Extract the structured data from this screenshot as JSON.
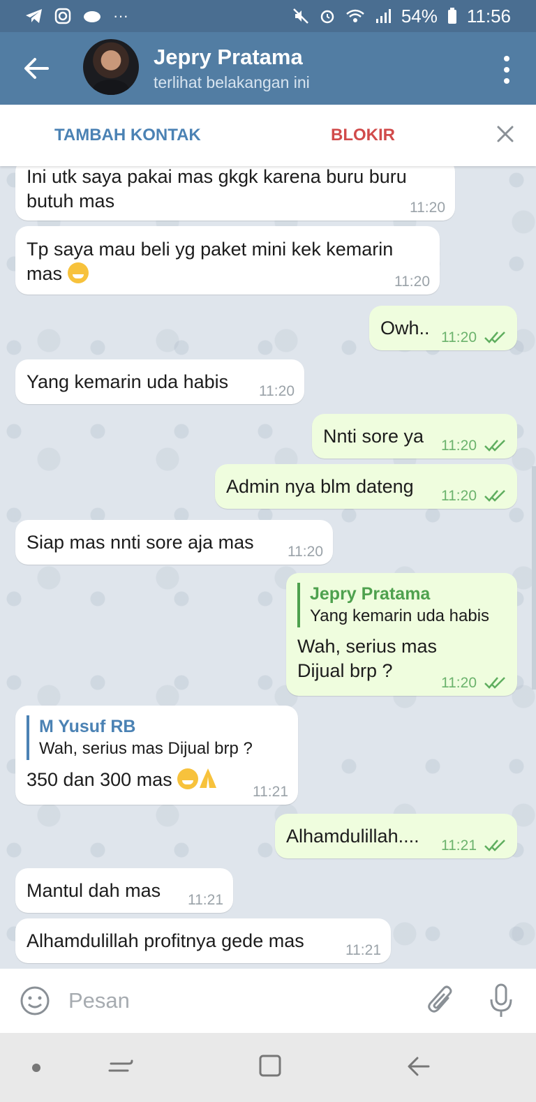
{
  "status_bar": {
    "battery": "54%",
    "time": "11:56"
  },
  "header": {
    "name": "Jepry Pratama",
    "status": "terlihat belakangan ini"
  },
  "action_bar": {
    "add_contact": "TAMBAH KONTAK",
    "block": "BLOKIR"
  },
  "messages": [
    {
      "dir": "in",
      "lines": [
        "Ini utk saya pakai mas gkgk karena buru buru",
        "butuh mas"
      ],
      "time": "11:20"
    },
    {
      "dir": "in",
      "lines": [
        "Tp saya mau beli yg paket mini kek kemarin",
        "mas"
      ],
      "time": "11:20",
      "emoji": "grin"
    },
    {
      "dir": "out",
      "text": "Owh..",
      "time": "11:20"
    },
    {
      "dir": "in",
      "text": "Yang kemarin uda habis",
      "time": "11:20"
    },
    {
      "dir": "out",
      "text": "Nnti sore ya",
      "time": "11:20"
    },
    {
      "dir": "out",
      "text": "Admin nya blm dateng",
      "time": "11:20"
    },
    {
      "dir": "in",
      "text": "Siap mas nnti sore aja mas",
      "time": "11:20"
    },
    {
      "dir": "out",
      "reply_name": "Jepry Pratama",
      "reply_text": "Yang kemarin uda habis",
      "lines": [
        "Wah, serius mas",
        "Dijual brp ?"
      ],
      "time": "11:20"
    },
    {
      "dir": "in",
      "reply_name": "M Yusuf RB",
      "reply_text": "Wah, serius mas Dijual brp ?",
      "text": "350 dan 300 mas",
      "time": "11:21",
      "emoji": "grin-pray"
    },
    {
      "dir": "out",
      "text": "Alhamdulillah....",
      "time": "11:21"
    },
    {
      "dir": "in",
      "text": "Mantul dah mas",
      "time": "11:21"
    },
    {
      "dir": "in",
      "text": "Alhamdulillah profitnya gede mas",
      "time": "11:21"
    }
  ],
  "composer": {
    "placeholder": "Pesan"
  },
  "icons": [
    "telegram-icon",
    "instagram-icon",
    "mute-icon",
    "alarm-icon",
    "wifi-icon",
    "signal-icon",
    "battery-icon",
    "back-arrow-icon",
    "more-vert-icon",
    "close-icon",
    "read-check-icon",
    "smile-icon",
    "attach-icon",
    "mic-icon"
  ]
}
